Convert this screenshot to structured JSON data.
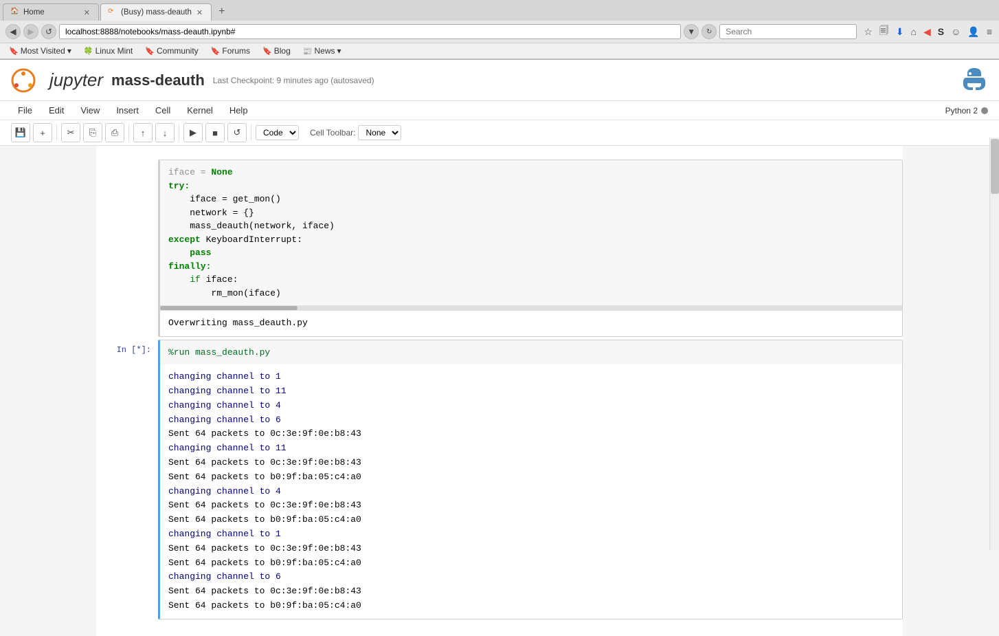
{
  "browser": {
    "tabs": [
      {
        "id": "tab1",
        "title": "Home",
        "active": false,
        "favicon": "🏠"
      },
      {
        "id": "tab2",
        "title": "(Busy) mass-deauth",
        "active": true,
        "favicon": "⟳"
      }
    ],
    "new_tab_btn": "+",
    "back_btn": "◀",
    "address": "localhost:8888/notebooks/mass-deauth.ipynb#",
    "search_placeholder": "Search",
    "toolbar_icons": [
      "★",
      "🗐",
      "⬇",
      "🏠",
      "◀",
      "S",
      "☺",
      "👤",
      "≡"
    ]
  },
  "bookmarks": [
    {
      "label": "Most Visited",
      "has_arrow": true
    },
    {
      "label": "Linux Mint"
    },
    {
      "label": "Community"
    },
    {
      "label": "Forums"
    },
    {
      "label": "Blog"
    },
    {
      "label": "News",
      "has_arrow": true
    }
  ],
  "jupyter": {
    "title": "jupyter",
    "notebook_name": "mass-deauth",
    "checkpoint": "Last Checkpoint: 9 minutes ago (autosaved)",
    "kernel": "Python 2",
    "kernel_status_dot": "gray",
    "menu_items": [
      "File",
      "Edit",
      "View",
      "Insert",
      "Cell",
      "Kernel",
      "Help"
    ],
    "toolbar_buttons": [
      "💾",
      "+",
      "✂",
      "⎘",
      "⎙",
      "↑",
      "↓",
      "▶",
      "■",
      "↺"
    ],
    "cell_type": "Code",
    "cell_toolbar_label": "Cell Toolbar:",
    "cell_toolbar_value": "None"
  },
  "cells": [
    {
      "id": "cell1",
      "type": "code",
      "label": "",
      "code_lines": [
        {
          "text": "iface = None",
          "class": "normal"
        },
        {
          "text": "try:",
          "class": "kw"
        },
        {
          "text": "    iface = get_mon()",
          "class": "normal"
        },
        {
          "text": "    network = {}",
          "class": "normal"
        },
        {
          "text": "    mass_deauth(network, iface)",
          "class": "normal"
        },
        {
          "text": "except KeyboardInterrupt:",
          "class": "kw"
        },
        {
          "text": "    pass",
          "class": "kw2"
        },
        {
          "text": "finally:",
          "class": "kw"
        },
        {
          "text": "    if iface:",
          "class": "normal"
        },
        {
          "text": "        rm_mon(iface)",
          "class": "normal"
        }
      ],
      "output": "Overwriting mass_deauth.py",
      "has_scrollbar": true
    },
    {
      "id": "cell2",
      "type": "code",
      "label": "In [*]:",
      "code_lines": [
        {
          "text": "%run mass_deauth.py",
          "class": "magic"
        }
      ],
      "output_lines": [
        {
          "text": "changing channel to 1",
          "class": "out-channel"
        },
        {
          "text": "changing channel to 11",
          "class": "out-channel"
        },
        {
          "text": "changing channel to 4",
          "class": "out-channel"
        },
        {
          "text": "changing channel to 6",
          "class": "out-channel"
        },
        {
          "text": "Sent 64 packets to 0c:3e:9f:0e:b8:43",
          "class": "out-sent"
        },
        {
          "text": "changing channel to 11",
          "class": "out-channel"
        },
        {
          "text": "Sent 64 packets to 0c:3e:9f:0e:b8:43",
          "class": "out-sent"
        },
        {
          "text": "Sent 64 packets to b0:9f:ba:05:c4:a0",
          "class": "out-sent"
        },
        {
          "text": "changing channel to 4",
          "class": "out-channel"
        },
        {
          "text": "Sent 64 packets to 0c:3e:9f:0e:b8:43",
          "class": "out-sent"
        },
        {
          "text": "Sent 64 packets to b0:9f:ba:05:c4:a0",
          "class": "out-sent"
        },
        {
          "text": "changing channel to 1",
          "class": "out-channel"
        },
        {
          "text": "Sent 64 packets to 0c:3e:9f:0e:b8:43",
          "class": "out-sent"
        },
        {
          "text": "Sent 64 packets to b0:9f:ba:05:c4:a0",
          "class": "out-sent"
        },
        {
          "text": "changing channel to 6",
          "class": "out-channel"
        },
        {
          "text": "Sent 64 packets to 0c:3e:9f:0e:b8:43",
          "class": "out-sent"
        },
        {
          "text": "Sent 64 packets to b0:9f:ba:05:c4:a0",
          "class": "out-sent"
        }
      ]
    }
  ]
}
